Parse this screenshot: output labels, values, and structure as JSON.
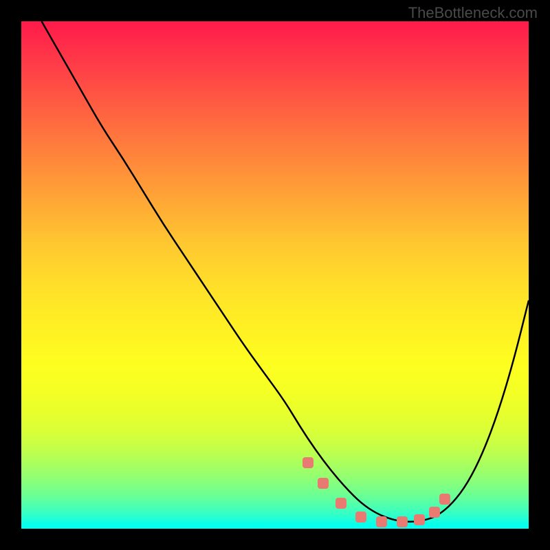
{
  "watermark": "TheBottleneck.com",
  "chart_data": {
    "type": "line",
    "title": "",
    "xlabel": "",
    "ylabel": "",
    "xlim": [
      0,
      100
    ],
    "ylim": [
      0,
      100
    ],
    "series": [
      {
        "name": "bottleneck-curve",
        "x": [
          4,
          8,
          12,
          16,
          20,
          24,
          28,
          32,
          36,
          40,
          44,
          48,
          52,
          55,
          58,
          61,
          64,
          67,
          70,
          73,
          76,
          79,
          82,
          85,
          88,
          91,
          94,
          97,
          100
        ],
        "y": [
          100,
          93,
          86,
          79,
          73,
          66.5,
          60,
          54,
          48,
          42,
          36,
          30.5,
          25,
          20,
          15.5,
          11.5,
          8,
          5,
          3,
          1.8,
          1.3,
          1.5,
          2.5,
          5,
          9,
          15,
          23,
          33,
          45
        ]
      }
    ],
    "markers": {
      "name": "bottleneck-points",
      "x": [
        56.5,
        59.5,
        63,
        67,
        71,
        75,
        78.5,
        81.5,
        83.5
      ],
      "y": [
        13,
        9,
        5,
        2.3,
        1.4,
        1.4,
        1.8,
        3.2,
        5.8
      ]
    },
    "gradient": {
      "top_color": "#ff1a4a",
      "mid_color": "#fff322",
      "bottom_color": "#00fff5"
    }
  }
}
